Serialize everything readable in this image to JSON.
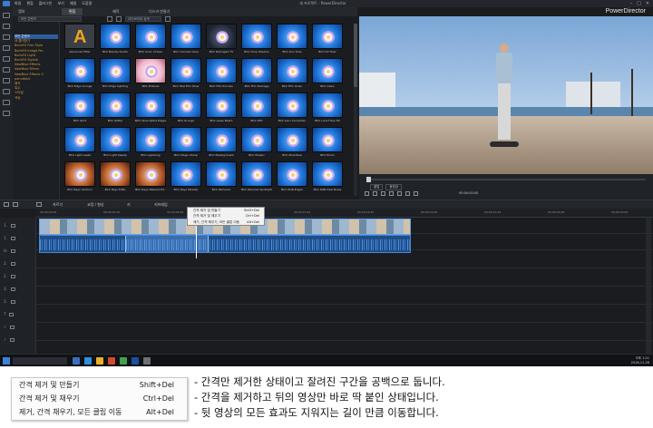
{
  "app": {
    "brand": "PowerDirector",
    "title": "새 프로젝트 - PowerDirector",
    "menu": [
      "파일",
      "편집",
      "플러그인",
      "보기",
      "재생",
      "도움말"
    ]
  },
  "room_tabs": {
    "items": [
      "캡처",
      "편집",
      "제작",
      "디스크 만들기"
    ],
    "active": 1
  },
  "search": {
    "category_placeholder": "모든 콘텐츠",
    "grid_placeholder": "라이브러리 검색"
  },
  "categories": [
    "모든 콘텐츠",
    "내 즐겨찾기",
    "BorisFX Film Style",
    "BorisFX Image Re..",
    "BorisFX Light",
    "BorisFX Stylize",
    "NewBlue Effects",
    "NewBlue Filters",
    "NewBlue Effects 3",
    "penultiArt",
    "왜곡",
    "특수",
    "스타일",
    "색상"
  ],
  "effects": [
    {
      "name": "Advanced Filter",
      "style": "adv"
    },
    {
      "name": "BCC Beauty Studio",
      "style": "blue"
    },
    {
      "name": "BCC Color Choser",
      "style": "blue"
    },
    {
      "name": "BCC Colorize Glow",
      "style": "blue"
    },
    {
      "name": "BCC Damaged TV",
      "style": "dark"
    },
    {
      "name": "BCC Drop Shadow",
      "style": "blue"
    },
    {
      "name": "BCC Duo Tone",
      "style": "blue"
    },
    {
      "name": "BCC DV Fixer",
      "style": "blue"
    },
    {
      "name": "BCC Edge Grunge",
      "style": "blue"
    },
    {
      "name": "BCC Edge Lighting",
      "style": "blue"
    },
    {
      "name": "BCC Emboss",
      "style": "pink"
    },
    {
      "name": "BCC Fast Film Glow",
      "style": "blue"
    },
    {
      "name": "BCC Film Process",
      "style": "blue"
    },
    {
      "name": "BCC Film Damage",
      "style": "blue"
    },
    {
      "name": "BCC Film Grain",
      "style": "blue"
    },
    {
      "name": "BCC Glare",
      "style": "blue"
    },
    {
      "name": "BCC Glint",
      "style": "blue"
    },
    {
      "name": "BCC Glitter",
      "style": "blue"
    },
    {
      "name": "BCC Glow Alpha Edges",
      "style": "blue"
    },
    {
      "name": "BCC Grunge",
      "style": "blue"
    },
    {
      "name": "BCC Laser Beam",
      "style": "blue"
    },
    {
      "name": "BCC LED",
      "style": "blue"
    },
    {
      "name": "BCC Lens Correction",
      "style": "blue"
    },
    {
      "name": "BCC Lens Flare 3D",
      "style": "blue"
    },
    {
      "name": "BCC Light Leaks",
      "style": "blue"
    },
    {
      "name": "BCC Light Sweep",
      "style": "blue"
    },
    {
      "name": "BCC Lightning",
      "style": "blue"
    },
    {
      "name": "BCC Magic Sharp",
      "style": "blue"
    },
    {
      "name": "BCC Misalignment",
      "style": "blue"
    },
    {
      "name": "BCC Mosaic",
      "style": "blue"
    },
    {
      "name": "BCC Pixel Rise",
      "style": "blue"
    },
    {
      "name": "BCC Prism",
      "style": "blue"
    },
    {
      "name": "BCC Rays Cartoon",
      "style": "warm"
    },
    {
      "name": "BCC Rays Puffy",
      "style": "warm"
    },
    {
      "name": "BCC Rays Radiant Ed..",
      "style": "warm"
    },
    {
      "name": "BCC Rays Streaky",
      "style": "blue"
    },
    {
      "name": "BCC Remover",
      "style": "blue"
    },
    {
      "name": "BCC Reverse Spotlight",
      "style": "blue"
    },
    {
      "name": "BCC RGB Edges",
      "style": "blue"
    },
    {
      "name": "BCC RGB Pixel Noise",
      "style": "blue"
    }
  ],
  "preview": {
    "modes": [
      "클립",
      "동영상"
    ],
    "timecode": "00:00:00:00"
  },
  "timeline": {
    "toolbar": [
      "",
      "",
      "자르기",
      "교정 / 향상",
      "키",
      "키프레임"
    ],
    "ruler": [
      "00:00:00:00",
      "00:00:03:10",
      "00:00:06:20",
      "00:00:10:00",
      "00:00:13:10",
      "00:00:16:20",
      "00:00:20:00",
      "00:00:23:10",
      "00:00:26:20",
      "00:00:30:00"
    ],
    "tracks": [
      "1.",
      "1.",
      "fx",
      "2.",
      "2.",
      "3.",
      "3.",
      "T",
      "♪",
      "♪"
    ]
  },
  "context_menu": [
    {
      "label": "간격 제거 및 만들기",
      "key": "Shift+Del"
    },
    {
      "label": "간격 제거 및 채우기",
      "key": "Ctrl+Del"
    },
    {
      "label": "제거, 간격 채우기, 모든 클립 이동",
      "key": "Alt+Del"
    }
  ],
  "taskbar": {
    "time": "오후 1:21",
    "date": "2018-11-26"
  },
  "explain_menu": [
    {
      "label": "간격 제거 및 만들기",
      "key": "Shift+Del"
    },
    {
      "label": "간격 제거 및 채우기",
      "key": "Ctrl+Del"
    },
    {
      "label": "제거, 간격 채우기, 모든 클립 이동",
      "key": "Alt+Del"
    }
  ],
  "notes": [
    "- 간격만 제거한 상태이고 잘려진 구간을 공백으로 둡니다.",
    "- 간격을 제거하고 뒤의 영상만 바로 딱 붙인 상태입니다.",
    "- 뒷 영상의 모든 효과도 지워지는 길이 만큼 이동합니다."
  ]
}
